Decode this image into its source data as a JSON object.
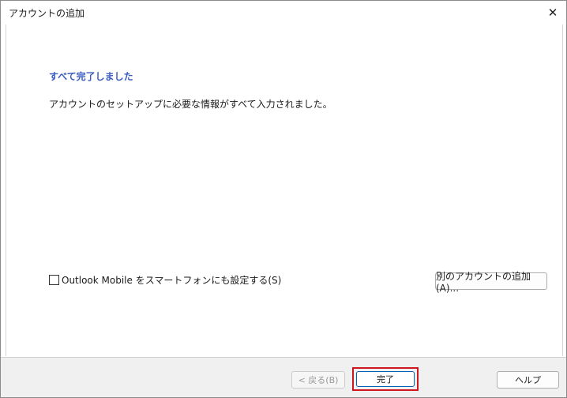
{
  "window": {
    "title": "アカウントの追加",
    "close_glyph": "✕"
  },
  "main": {
    "heading": "すべて完了しました",
    "description": "アカウントのセットアップに必要な情報がすべて入力されました。",
    "checkbox_label": "Outlook Mobile をスマートフォンにも設定する(S)",
    "checkbox_checked": false,
    "add_another_label": "別のアカウントの追加(A)..."
  },
  "footer": {
    "back_label": "< 戻る(B)",
    "finish_label": "完了",
    "help_label": "ヘルプ"
  },
  "colors": {
    "heading": "#3a5bbf",
    "highlight_border": "#d0161e",
    "primary_border": "#005fb8"
  }
}
